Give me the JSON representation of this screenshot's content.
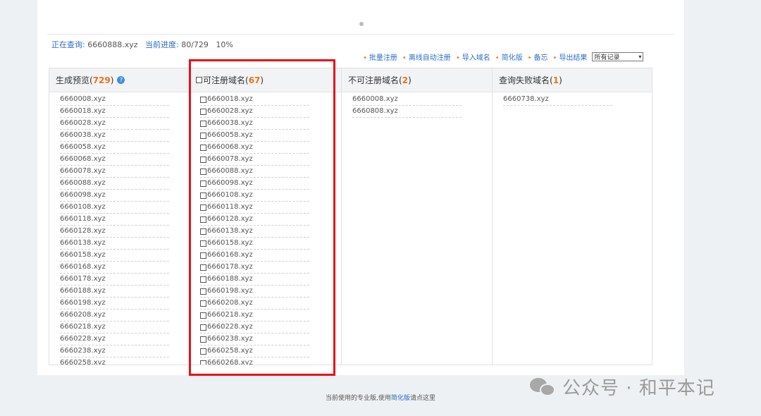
{
  "status": {
    "querying_label": "正在查询:",
    "querying_value": "6660888.xyz",
    "progress_label": "当前进度:",
    "progress_value": "80/729",
    "progress_percent": "10%"
  },
  "toolbar": {
    "links": [
      "批量注册",
      "离线自动注册",
      "导入域名",
      "简化版",
      "备忘",
      "导出结果"
    ],
    "select_value": "所有记录"
  },
  "columns": {
    "preview": {
      "title": "生成预览",
      "count": "729",
      "items": [
        "6660008.xyz",
        "6660018.xyz",
        "6660028.xyz",
        "6660038.xyz",
        "6660058.xyz",
        "6660068.xyz",
        "6660078.xyz",
        "6660088.xyz",
        "6660098.xyz",
        "6660108.xyz",
        "6660118.xyz",
        "6660128.xyz",
        "6660138.xyz",
        "6660158.xyz",
        "6660168.xyz",
        "6660178.xyz",
        "6660188.xyz",
        "6660198.xyz",
        "6660208.xyz",
        "6660218.xyz",
        "6660228.xyz",
        "6660238.xyz",
        "6660258.xyz"
      ]
    },
    "available": {
      "title": "可注册域名",
      "count": "67",
      "items": [
        "6660018.xyz",
        "6660028.xyz",
        "6660038.xyz",
        "6660058.xyz",
        "6660068.xyz",
        "6660078.xyz",
        "6660088.xyz",
        "6660098.xyz",
        "6660108.xyz",
        "6660118.xyz",
        "6660128.xyz",
        "6660138.xyz",
        "6660158.xyz",
        "6660168.xyz",
        "6660178.xyz",
        "6660188.xyz",
        "6660198.xyz",
        "6660208.xyz",
        "6660218.xyz",
        "6660228.xyz",
        "6660238.xyz",
        "6660258.xyz",
        "6660268.xyz"
      ]
    },
    "unavailable": {
      "title": "不可注册域名",
      "count": "2",
      "items": [
        "6660008.xyz",
        "6660808.xyz"
      ]
    },
    "failed": {
      "title": "查询失败域名",
      "count": "1",
      "items": [
        "6660738.xyz"
      ]
    }
  },
  "footer": {
    "prefix": "当前使用的专业版,使用",
    "link": "简化版",
    "suffix": "请点这里"
  },
  "watermark": {
    "text": "公众号 · 和平本记"
  },
  "colors": {
    "accent_link": "#2a6cc7",
    "count_orange": "#e8741a",
    "highlight_red": "#e8111a"
  }
}
